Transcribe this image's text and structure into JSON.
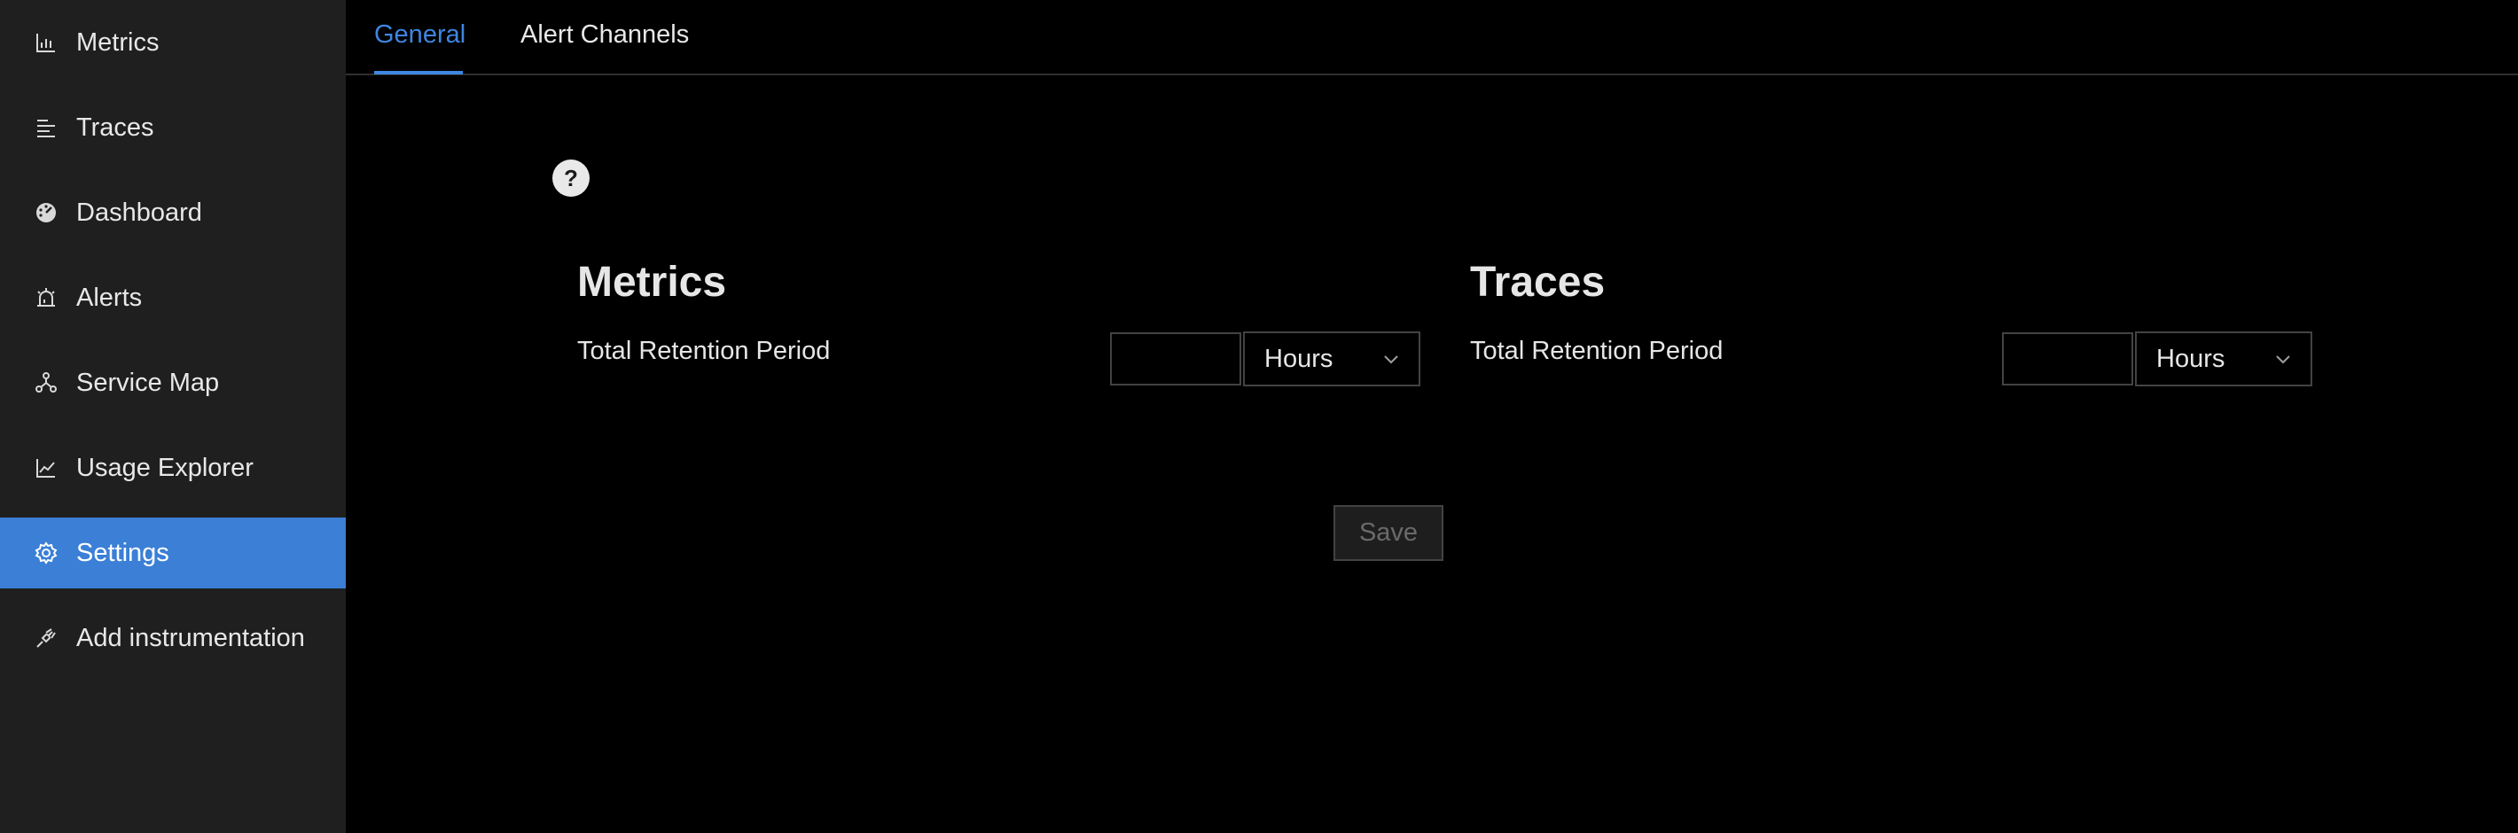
{
  "sidebar": {
    "items": [
      {
        "label": "Metrics",
        "icon": "bar-chart-icon",
        "active": false
      },
      {
        "label": "Traces",
        "icon": "list-lines-icon",
        "active": false
      },
      {
        "label": "Dashboard",
        "icon": "dashboard-gauge-icon",
        "active": false
      },
      {
        "label": "Alerts",
        "icon": "alarm-icon",
        "active": false
      },
      {
        "label": "Service Map",
        "icon": "deployment-unit-icon",
        "active": false
      },
      {
        "label": "Usage Explorer",
        "icon": "line-chart-icon",
        "active": false
      },
      {
        "label": "Settings",
        "icon": "gear-icon",
        "active": true
      },
      {
        "label": "Add instrumentation",
        "icon": "api-plug-icon",
        "active": false
      }
    ],
    "active_color": "#3b7fd6",
    "background": "#1f1f1f"
  },
  "tabs": [
    {
      "label": "General",
      "active": true
    },
    {
      "label": "Alert Channels",
      "active": false
    }
  ],
  "help": {
    "icon": "question-circle-icon"
  },
  "sections": {
    "metrics": {
      "title": "Metrics",
      "field_label": "Total Retention Period",
      "value": "",
      "unit": "Hours"
    },
    "traces": {
      "title": "Traces",
      "field_label": "Total Retention Period",
      "value": "",
      "unit": "Hours"
    }
  },
  "save_button": {
    "label": "Save",
    "disabled": true
  },
  "colors": {
    "accent": "#3f86e0",
    "background": "#000000",
    "border": "#434343"
  }
}
